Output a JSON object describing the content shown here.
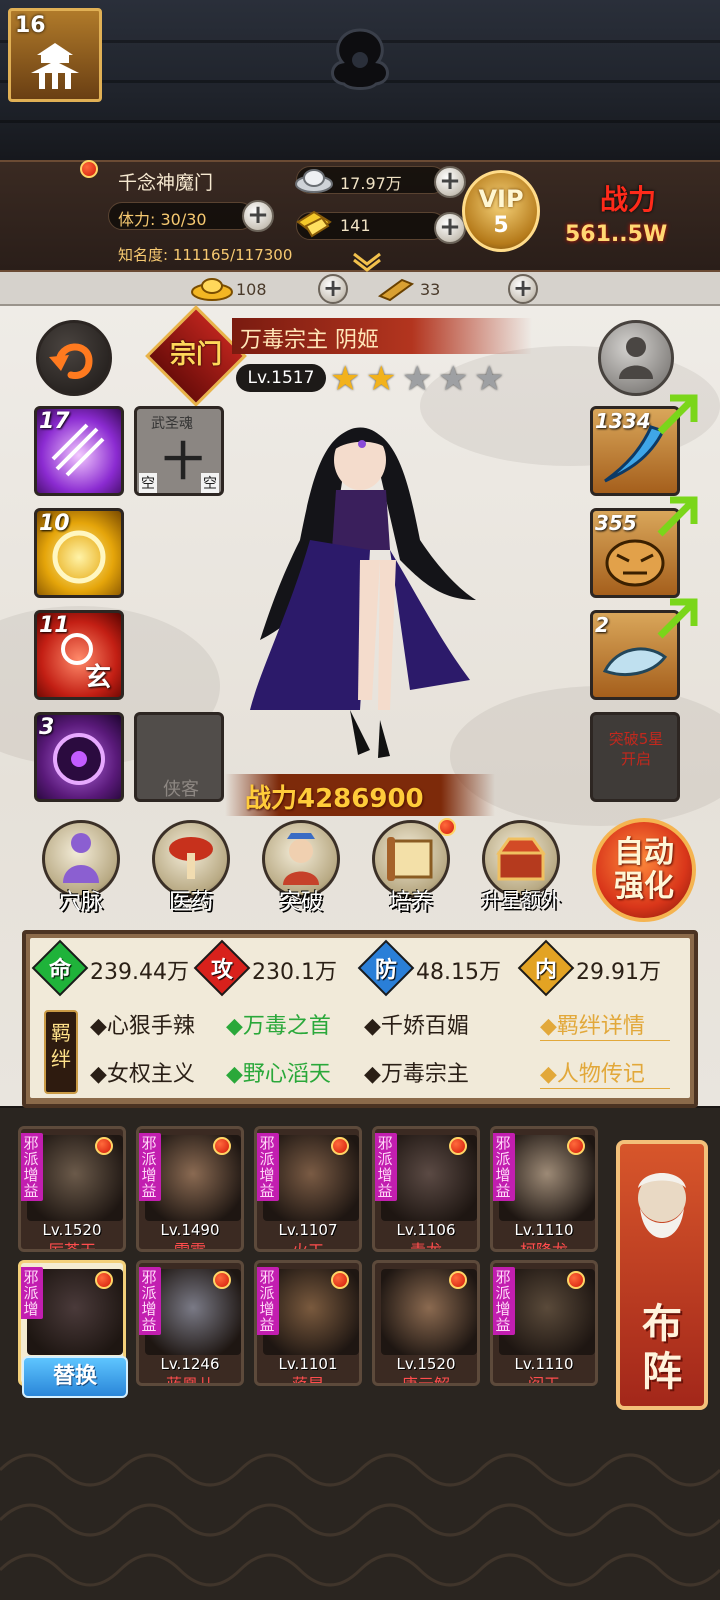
{
  "header": {
    "level": "16",
    "nickname": "千念神魔门",
    "stamina_label": "体力: 30/30",
    "fame_label": "知名度: 111165/117300",
    "silver": "17.97万",
    "gold": "141",
    "vip_label": "VIP",
    "vip_level": "5",
    "power_label": "战力",
    "power_value": "561..5W"
  },
  "resources": {
    "ingot": "108",
    "token": "33"
  },
  "hero": {
    "title_emblem": "宗门",
    "name": "万毒宗主 阴姬",
    "level": "Lv.1517",
    "stars_filled": 2,
    "stars_total": 5,
    "power": "战力4286900"
  },
  "left_slots": [
    {
      "count": "17",
      "color": "#8b2bd1"
    },
    {
      "label_top": "武圣魂",
      "label_mid": "十",
      "label_bl": "空",
      "label_br": "空"
    },
    {
      "count": "10",
      "color": "#e5a50a"
    },
    {
      "count": "11",
      "color": "#c31f14",
      "label": "玄"
    },
    {
      "count": "3",
      "color": "#5a1a7a"
    },
    {
      "label": "侠客"
    }
  ],
  "right_slots": [
    {
      "count": "1334"
    },
    {
      "count": "355"
    },
    {
      "count": "2"
    },
    {
      "label": "突破5星开启"
    }
  ],
  "functions": [
    {
      "label": "穴脉"
    },
    {
      "label": "医药"
    },
    {
      "label": "突破"
    },
    {
      "label": "培养"
    },
    {
      "label": "升星额外"
    }
  ],
  "auto_button": "自动强化",
  "attributes": [
    {
      "icon": "命",
      "value": "239.44万",
      "color": "#1fb33a"
    },
    {
      "icon": "攻",
      "value": "230.1万",
      "color": "#d8211c"
    },
    {
      "icon": "防",
      "value": "48.15万",
      "color": "#2a7fd8"
    },
    {
      "icon": "内",
      "value": "29.91万",
      "color": "#e3a323"
    }
  ],
  "bonds_label": "羁绊",
  "bonds": [
    {
      "text": "◆心狠手辣",
      "green": false
    },
    {
      "text": "◆万毒之首",
      "green": true
    },
    {
      "text": "◆千娇百媚",
      "green": false
    },
    {
      "text": "◆女权主义",
      "green": false
    },
    {
      "text": "◆野心滔天",
      "green": true
    },
    {
      "text": "◆万毒宗主",
      "green": false
    }
  ],
  "links": {
    "bond_detail": "◆羁绊详情",
    "biography": "◆人物传记"
  },
  "team": [
    {
      "tag": "邪派增益",
      "level": "Lv.1520",
      "name": "厉苍天",
      "skin": "#6b5a4a"
    },
    {
      "tag": "邪派增益",
      "level": "Lv.1490",
      "name": "雷震",
      "skin": "#8a6a52"
    },
    {
      "tag": "邪派增益",
      "level": "Lv.1107",
      "name": "火工",
      "skin": "#7a5b44"
    },
    {
      "tag": "邪派增益",
      "level": "Lv.1106",
      "name": "青龙",
      "skin": "#5b4a44"
    },
    {
      "tag": "邪派增益",
      "level": "Lv.1110",
      "name": "柯降龙",
      "skin": "#9d8a76"
    },
    {
      "tag": "邪派增",
      "level": "",
      "name": "",
      "skin": "#4a3a3a"
    },
    {
      "tag": "邪派增益",
      "level": "Lv.1246",
      "name": "蓝凰儿",
      "skin": "#7a7a86"
    },
    {
      "tag": "邪派增益",
      "level": "Lv.1101",
      "name": "蒋昆",
      "skin": "#7a5a3e"
    },
    {
      "tag": "",
      "level": "Lv.1520",
      "name": "唐元解",
      "skin": "#8b6a50"
    },
    {
      "tag": "邪派增益",
      "level": "Lv.1110",
      "name": "阎王",
      "skin": "#5a4a3a"
    }
  ],
  "replace_button": "替换",
  "deploy_button": "布阵"
}
